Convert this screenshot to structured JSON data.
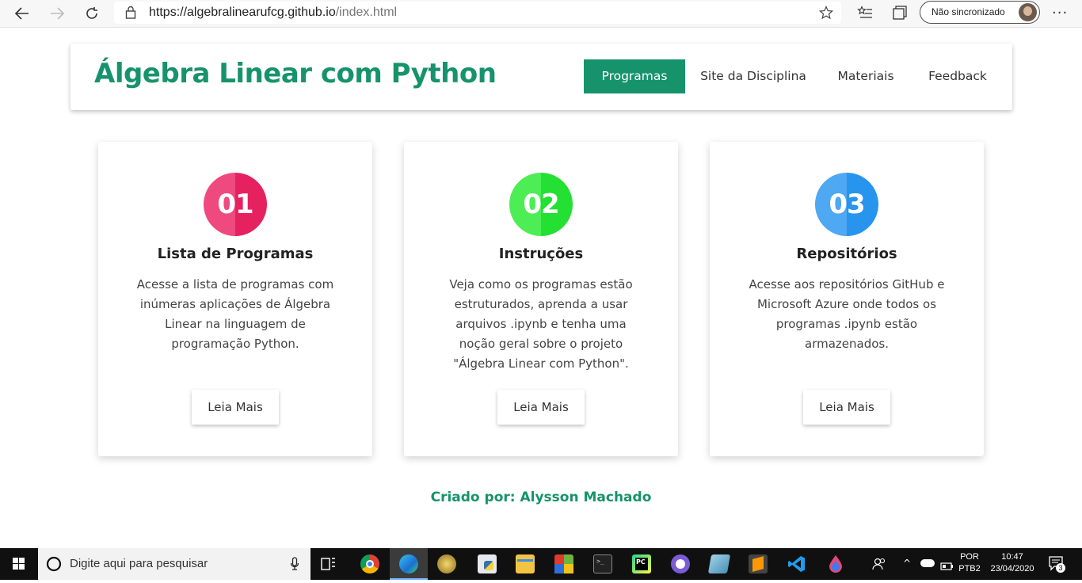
{
  "browser": {
    "url_host": "https://algebralinearufcg.github.io",
    "url_path": "/index.html",
    "sync_label": "Não sincronizado"
  },
  "header": {
    "title": "Álgebra Linear com Python",
    "nav": [
      "Programas",
      "Site da Disciplina",
      "Materiais",
      "Feedback"
    ]
  },
  "cards": [
    {
      "number": "01",
      "title": "Lista de Programas",
      "lines": [
        "Acesse a lista de programas com",
        "inúmeras aplicações de Álgebra",
        "Linear na linguagem de",
        "programação Python."
      ],
      "button": "Leia Mais",
      "colors": {
        "left": "#ee4a80",
        "right": "#e6215f"
      }
    },
    {
      "number": "02",
      "title": "Instruções",
      "lines": [
        "Veja como os programas estão",
        "estruturados, aprenda a usar",
        "arquivos .ipynb e tenha uma",
        "noção geral sobre o projeto",
        "\"Álgebra Linear com Python\"."
      ],
      "button": "Leia Mais",
      "colors": {
        "left": "#4ded56",
        "right": "#23e032"
      }
    },
    {
      "number": "03",
      "title": "Repositórios",
      "lines": [
        "Acesse aos repositórios GitHub e",
        "Microsoft Azure onde todos os",
        "programas .ipynb estão",
        "armazenados."
      ],
      "button": "Leia Mais",
      "colors": {
        "left": "#4ea8f2",
        "right": "#2794ee"
      }
    }
  ],
  "footer": {
    "credit": "Criado por: Alysson Machado"
  },
  "taskbar": {
    "search_placeholder": "Digite aqui para pesquisar",
    "lang_top": "POR",
    "lang_bottom": "PTB2",
    "time": "10:47",
    "date": "23/04/2020",
    "notif_count": "3"
  },
  "colors": {
    "accent": "#17936b"
  }
}
